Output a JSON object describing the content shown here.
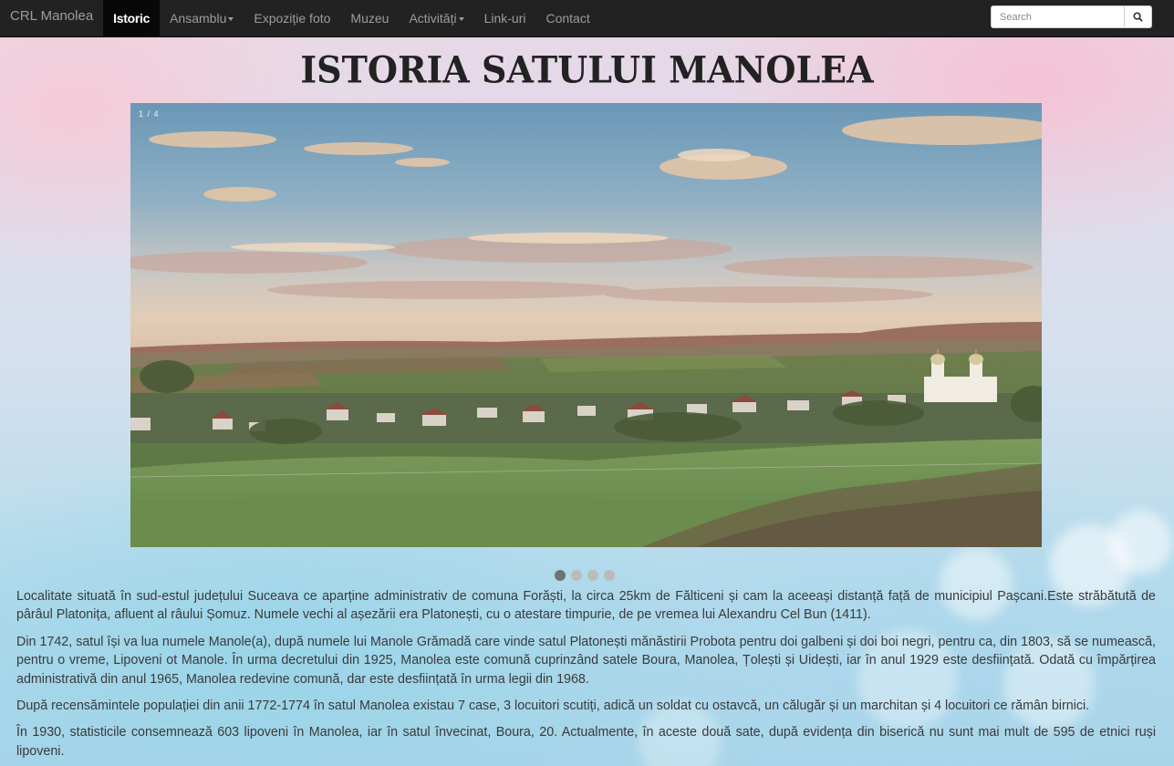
{
  "navbar": {
    "brand": "CRL Manolea",
    "items": [
      {
        "label": "Istoric",
        "active": true,
        "dropdown": false
      },
      {
        "label": "Ansamblu",
        "active": false,
        "dropdown": true
      },
      {
        "label": "Expoziție foto",
        "active": false,
        "dropdown": false
      },
      {
        "label": "Muzeu",
        "active": false,
        "dropdown": false
      },
      {
        "label": "Activități",
        "active": false,
        "dropdown": true
      },
      {
        "label": "Link-uri",
        "active": false,
        "dropdown": false
      },
      {
        "label": "Contact",
        "active": false,
        "dropdown": false
      }
    ],
    "search": {
      "placeholder": "Search",
      "value": "",
      "button_icon": "search-icon"
    }
  },
  "title": "ISTORIA SATULUI MANOLEA",
  "carousel": {
    "counter": "1 / 4",
    "current": 1,
    "total": 4
  },
  "paragraphs": [
    "Localitate situată în sud-estul județului Suceava ce aparține administrativ de comuna Forăști, la circa 25km de Fălticeni și cam la aceeași distanță față de municipiul Pașcani.Este străbătută de pârâul Platonița, afluent al râului Șomuz. Numele vechi al așezării era Platonești, cu o atestare timpurie, de pe vremea lui Alexandru Cel Bun (1411).",
    "Din 1742, satul își va lua numele Manole(a), după numele lui Manole Grămadă care vinde satul Platonești mănăstirii Probota pentru doi galbeni și doi boi negri, pentru ca, din 1803, să se numească, pentru o vreme, Lipoveni ot Manole. În urma decretului din 1925, Manolea este comună cuprinzând satele Boura, Manolea, Țolești și Uidești, iar în anul 1929 este desființată. Odată cu împărțirea administrativă din anul 1965, Manolea redevine comună, dar este desființată în urma legii din 1968.",
    "După recensămintele populației din anii 1772-1774 în satul Manolea existau 7 case, 3 locuitori scutiți, adică un soldat cu ostavcă, un călugăr și un marchitan și 4 locuitori ce rămân birnici.",
    "În 1930, statisticile consemnează 603 lipoveni în Manolea, iar în satul învecinat, Boura, 20. Actualmente, în aceste două sate, după evidența din biserică nu sunt mai mult de 595 de etnici ruși lipoveni."
  ]
}
